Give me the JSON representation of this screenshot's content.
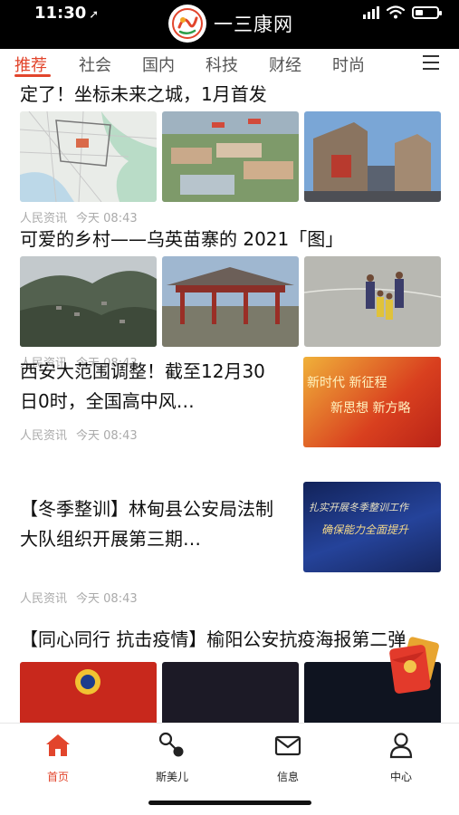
{
  "status_bar": {
    "time": "11:30"
  },
  "app": {
    "name": "一三康网"
  },
  "tabs": [
    "推荐",
    "社会",
    "国内",
    "科技",
    "财经",
    "时尚"
  ],
  "articles": [
    {
      "title": "定了！坐标未来之城，1月首发",
      "source": "人民资讯",
      "time": "今天 08:43"
    },
    {
      "title": "可爱的乡村——乌英苗寨的 2021「图」",
      "source": "人民资讯",
      "time": "今天 08:43"
    },
    {
      "title": "西安大范围调整！截至12月30日0时，全国高中风…",
      "source": "人民资讯",
      "time": "今天 08:43",
      "image_text": [
        "新时代 新征程",
        "新思想 新方略"
      ]
    },
    {
      "title": "【冬季整训】林甸县公安局法制大队组织开展第三期…",
      "source": "人民资讯",
      "time": "今天 08:43",
      "image_text": [
        "扎实开展冬季整训工作",
        "确保能力全面提升"
      ]
    },
    {
      "title": "【同心同行 抗击疫情】榆阳公安抗疫海报第二弹"
    }
  ],
  "bottom_nav": [
    {
      "label": "首页",
      "icon": "home-icon",
      "active": true
    },
    {
      "label": "斯美儿",
      "icon": "share-icon",
      "active": false
    },
    {
      "label": "信息",
      "icon": "mail-icon",
      "active": false
    },
    {
      "label": "中心",
      "icon": "person-icon",
      "active": false
    }
  ],
  "colors": {
    "accent": "#e2452c",
    "topbar": "#000000"
  }
}
